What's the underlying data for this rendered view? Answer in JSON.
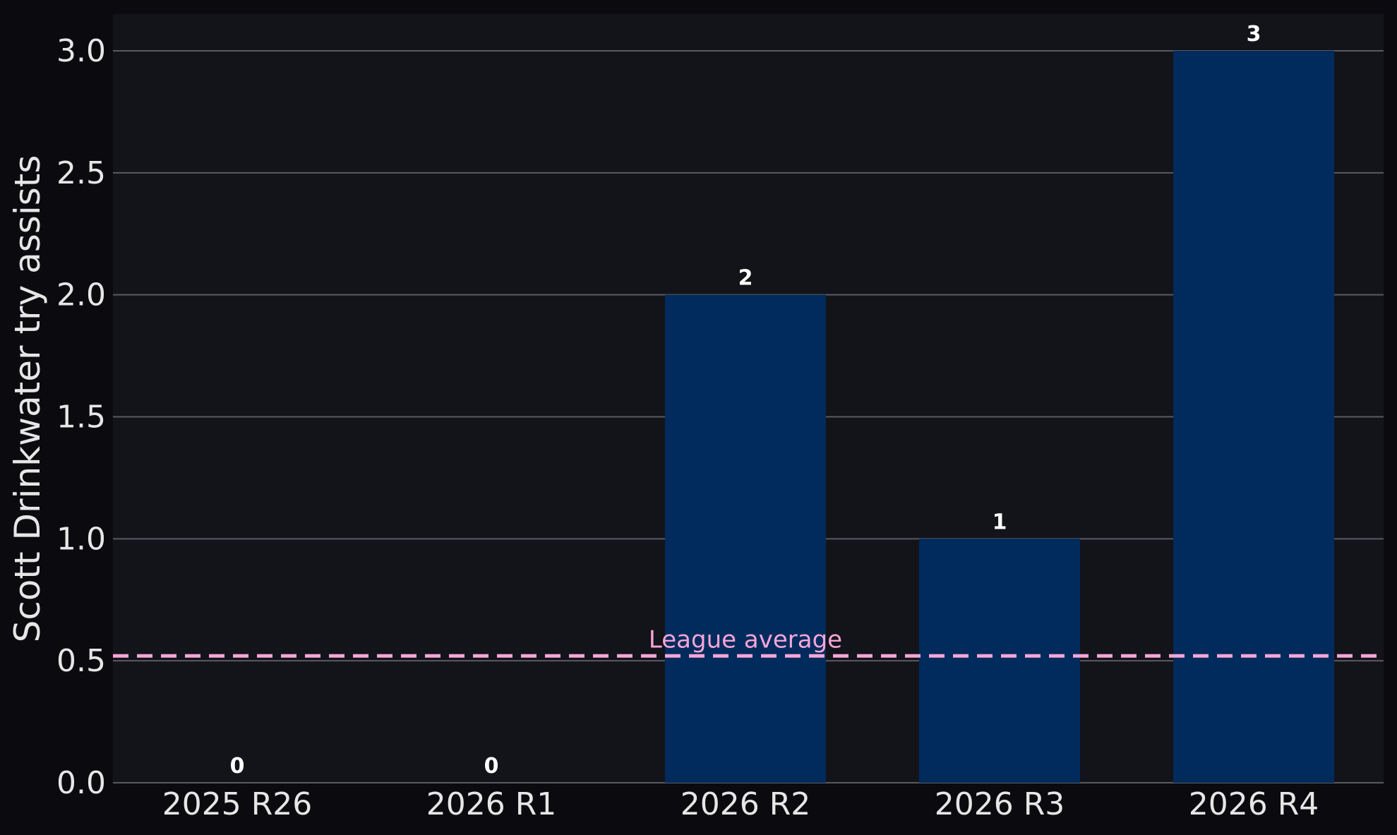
{
  "chart_data": {
    "type": "bar",
    "categories": [
      "2025 R26",
      "2026 R1",
      "2026 R2",
      "2026 R3",
      "2026 R4"
    ],
    "values": [
      0,
      0,
      2,
      1,
      3
    ],
    "data_labels": [
      "0",
      "0",
      "2",
      "1",
      "3"
    ],
    "ylabel": "Scott Drinkwater try assists",
    "xlabel": "",
    "ylim": [
      0,
      3.15
    ],
    "yticks": [
      0.0,
      0.5,
      1.0,
      1.5,
      2.0,
      2.5,
      3.0
    ],
    "ytick_labels": [
      "0.0",
      "0.5",
      "1.0",
      "1.5",
      "2.0",
      "2.5",
      "3.0"
    ],
    "grid": "horizontal",
    "reference_line": {
      "label": "League average",
      "value": 0.52,
      "style": "dashed",
      "color": "#f4a6d7"
    },
    "colors": {
      "bar": "#002b5c",
      "plot_background": "#13131a",
      "figure_background": "#0b0b0f",
      "grid": "#5a5a60",
      "text": "#e6e6e6"
    }
  }
}
